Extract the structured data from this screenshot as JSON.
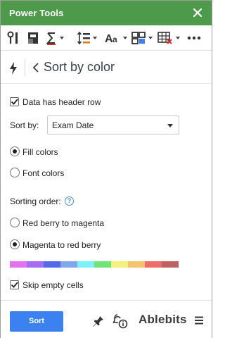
{
  "window": {
    "title": "Power Tools"
  },
  "toolbar": {
    "items": [
      {
        "icon": "find-replace-icon"
      },
      {
        "icon": "data-cleanup-icon"
      },
      {
        "icon": "sum-icon",
        "has_dropdown": true
      },
      {
        "icon": "line-spacing-icon",
        "has_dropdown": true
      },
      {
        "icon": "text-case-icon",
        "has_dropdown": true
      },
      {
        "icon": "layout-grid-icon",
        "has_dropdown": true
      },
      {
        "icon": "clear-table-icon",
        "has_dropdown": true
      },
      {
        "icon": "more-icon"
      }
    ]
  },
  "header": {
    "title": "Sort by color"
  },
  "options": {
    "header_row_label": "Data has header row",
    "header_row_checked": true,
    "sort_by_label": "Sort by:",
    "sort_by_value": "Exam Date",
    "color_type": [
      {
        "label": "Fill colors",
        "selected": true
      },
      {
        "label": "Font colors",
        "selected": false
      }
    ],
    "sorting_order_label": "Sorting order:",
    "help_glyph": "?",
    "order": [
      {
        "label": "Red berry to magenta",
        "selected": false
      },
      {
        "label": "Magenta to red berry",
        "selected": true
      }
    ],
    "palette": [
      "#e371f0",
      "#a86cf2",
      "#5569e6",
      "#7fa7ea",
      "#7ef0f7",
      "#74e27a",
      "#f4f27b",
      "#f5c26d",
      "#ef6c6c",
      "#c06161"
    ],
    "skip_empty_label": "Skip empty cells",
    "skip_empty_checked": true
  },
  "footer": {
    "sort_label": "Sort",
    "brand": "Ablebits"
  },
  "colors": {
    "titlebar": "#4d9a4a",
    "primary_button": "#3b82f0",
    "help": "#4a88d6"
  }
}
